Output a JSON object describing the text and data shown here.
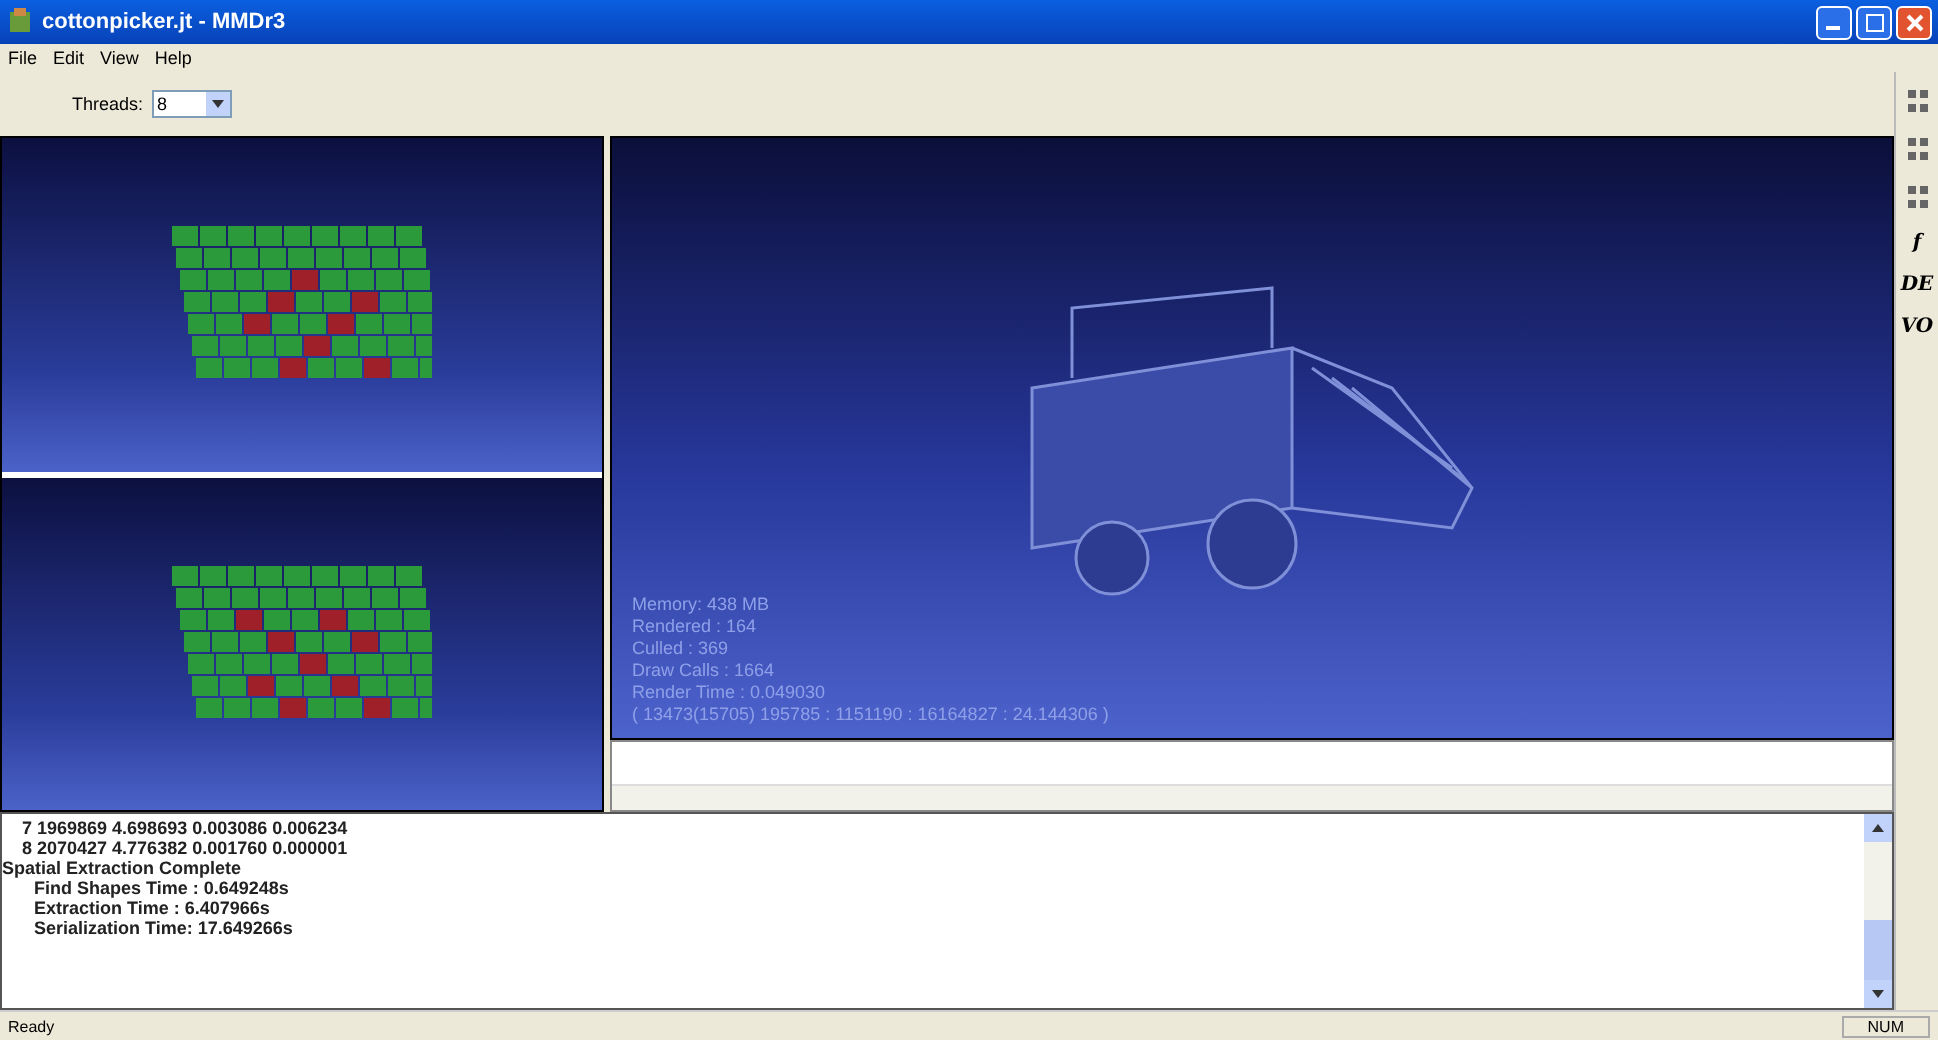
{
  "window": {
    "title": "cottonpicker.jt - MMDr3"
  },
  "menu": [
    "File",
    "Edit",
    "View",
    "Help"
  ],
  "toolbar": {
    "threads_label": "Threads:",
    "threads_value": "8"
  },
  "viewport": {
    "stats": [
      "Memory: 438 MB",
      "Rendered : 164",
      "Culled : 369",
      "Draw Calls : 1664",
      "Render Time : 0.049030",
      "( 13473(15705) 195785 : 1151190 : 16164827 : 24.144306 )"
    ]
  },
  "side_tools": [
    {
      "kind": "icon"
    },
    {
      "kind": "icon"
    },
    {
      "kind": "icon"
    },
    {
      "kind": "text",
      "label": "f"
    },
    {
      "kind": "text",
      "label": "DE"
    },
    {
      "kind": "text",
      "label": "VO"
    }
  ],
  "log": [
    {
      "kind": "data",
      "text": "7 1969869 4.698693 0.003086 0.006234"
    },
    {
      "kind": "data",
      "text": "8 2070427 4.776382 0.001760 0.000001"
    },
    {
      "kind": "header",
      "text": "Spatial Extraction Complete"
    },
    {
      "kind": "detail",
      "text": "Find Shapes Time : 0.649248s"
    },
    {
      "kind": "detail",
      "text": "Extraction Time : 6.407966s"
    },
    {
      "kind": "detail",
      "text": "Serialization Time: 17.649266s"
    }
  ],
  "status_bar": {
    "text": "Ready",
    "indicator": "NUM"
  }
}
